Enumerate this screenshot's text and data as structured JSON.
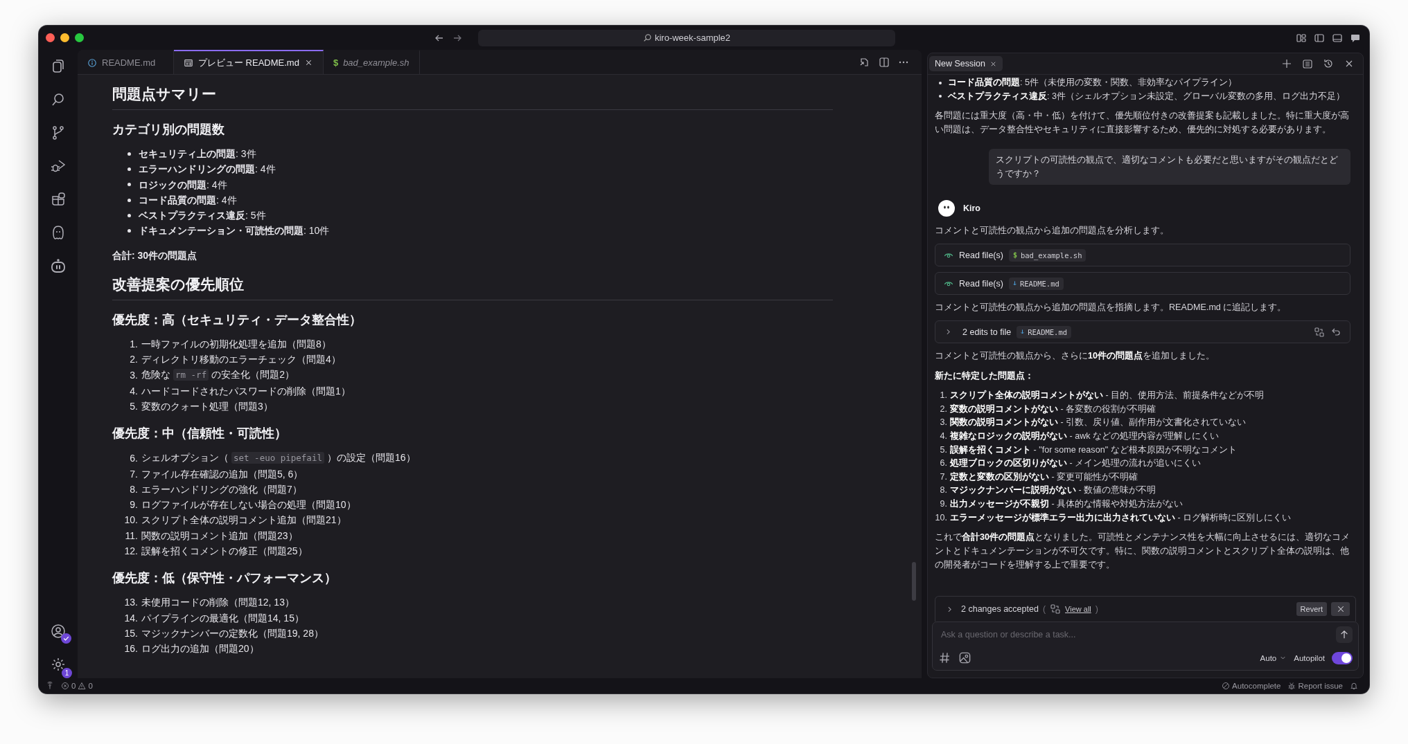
{
  "window": {
    "search_label": "kiro-week-sample2"
  },
  "activity_bar": {
    "settings_badge": "1"
  },
  "editor": {
    "tabs": [
      {
        "label": "README.md",
        "kind": "info",
        "selected": false,
        "preview_mode": false
      },
      {
        "label": "プレビュー README.md",
        "kind": "preview",
        "selected": true,
        "preview_mode": false
      },
      {
        "label": "bad_example.sh",
        "kind": "shell",
        "glyph": "$",
        "selected": false,
        "preview_mode": true
      }
    ],
    "blocks": [
      {
        "kind": "h1",
        "text": "問題点サマリー"
      },
      {
        "kind": "h2",
        "text": "カテゴリ別の問題数"
      },
      {
        "kind": "ul",
        "items": [
          "**セキュリティ上の問題**: 3件",
          "**エラーハンドリングの問題**: 4件",
          "**ロジックの問題**: 4件",
          "**コード品質の問題**: 4件",
          "**ベストプラクティス違反**: 5件",
          "**ドキュメンテーション・可読性の問題**: 10件"
        ]
      },
      {
        "kind": "p",
        "bold": true,
        "text": "合計: 30件の問題点"
      },
      {
        "kind": "h1",
        "text": "改善提案の優先順位"
      },
      {
        "kind": "h2",
        "text": "優先度：高（セキュリティ・データ整合性）"
      },
      {
        "kind": "ol",
        "items": [
          {
            "number": "1.",
            "text": "一時ファイルの初期化処理を追加（問題8）"
          },
          {
            "number": "2.",
            "text": "ディレクトリ移動のエラーチェック（問題4）"
          },
          {
            "number": "3.",
            "text": "危険な",
            "code": "rm -rf",
            "after": "の安全化（問題2）"
          },
          {
            "number": "4.",
            "text": "ハードコードされたパスワードの削除（問題1）"
          },
          {
            "number": "5.",
            "text": "変数のクォート処理（問題3）"
          }
        ]
      },
      {
        "kind": "h2",
        "text": "優先度：中（信頼性・可読性）"
      },
      {
        "kind": "ol",
        "items": [
          {
            "number": "6.",
            "text": "シェルオプション（",
            "code": "set -euo pipefail",
            "after": "）の設定（問題16）"
          },
          {
            "number": "7.",
            "text": "ファイル存在確認の追加（問題5, 6）"
          },
          {
            "number": "8.",
            "text": "エラーハンドリングの強化（問題7）"
          },
          {
            "number": "9.",
            "text": "ログファイルが存在しない場合の処理（問題10）"
          },
          {
            "number": "10.",
            "text": "スクリプト全体の説明コメント追加（問題21）"
          },
          {
            "number": "11.",
            "text": "関数の説明コメント追加（問題23）"
          },
          {
            "number": "12.",
            "text": "誤解を招くコメントの修正（問題25）"
          }
        ]
      },
      {
        "kind": "h2",
        "text": "優先度：低（保守性・パフォーマンス）"
      },
      {
        "kind": "ol",
        "items": [
          {
            "number": "13.",
            "text": "未使用コードの削除（問題12, 13）"
          },
          {
            "number": "14.",
            "text": "パイプラインの最適化（問題14, 15）"
          },
          {
            "number": "15.",
            "text": "マジックナンバーの定数化（問題19, 28）"
          },
          {
            "number": "16.",
            "text": "ログ出力の追加（問題20）"
          }
        ]
      }
    ]
  },
  "chat": {
    "tab": "New Session",
    "messages": [
      {
        "kind": "ul",
        "items": [
          "**コード品質の問題**: 5件（未使用の変数・関数、非効率なパイプライン）",
          "**ベストプラクティス違反**: 3件（シェルオプション未設定、グローバル変数の多用、ログ出力不足）"
        ]
      },
      {
        "kind": "p",
        "text": "各問題には重大度（高・中・低）を付けて、優先順位付きの改善提案も記載しました。特に重大度が高い問題は、データ整合性やセキュリティに直接影響するため、優先的に対処する必要があります。"
      },
      {
        "kind": "user",
        "text": "スクリプトの可読性の観点で、適切なコメントも必要だと思いますがその観点だとどうですか？"
      },
      {
        "kind": "author",
        "text": "Kiro"
      },
      {
        "kind": "p",
        "text": "コメントと可読性の観点から追加の問題点を分析します。"
      },
      {
        "kind": "tool",
        "text": "Read file(s)",
        "file": "bad_example.sh",
        "glyph": "$"
      },
      {
        "kind": "tool",
        "text": "Read file(s)",
        "file": "README.md"
      },
      {
        "kind": "p",
        "text": "コメントと可読性の観点から追加の問題点を指摘します。README.md に追記します。"
      },
      {
        "kind": "edits",
        "text": "2 edits to file",
        "file": "README.md"
      },
      {
        "kind": "p",
        "text": "コメントと可読性の観点から、さらに**10件の問題点**を追加しました。"
      },
      {
        "kind": "p",
        "bold": true,
        "text": "新たに特定した問題点："
      },
      {
        "kind": "ol",
        "items": [
          {
            "number": "1.",
            "text": "**スクリプト全体の説明コメントがない** - 目的、使用方法、前提条件などが不明"
          },
          {
            "number": "2.",
            "text": "**変数の説明コメントがない** - 各変数の役割が不明確"
          },
          {
            "number": "3.",
            "text": "**関数の説明コメントがない** - 引数、戻り値、副作用が文書化されていない"
          },
          {
            "number": "4.",
            "text": "**複雑なロジックの説明がない** - awk などの処理内容が理解しにくい"
          },
          {
            "number": "5.",
            "text": "**誤解を招くコメント** - \"for some reason\" など根本原因が不明なコメント"
          },
          {
            "number": "6.",
            "text": "**処理ブロックの区切りがない** - メイン処理の流れが追いにくい"
          },
          {
            "number": "7.",
            "text": "**定数と変数の区別がない** - 変更可能性が不明確"
          },
          {
            "number": "8.",
            "text": "**マジックナンバーに説明がない** - 数値の意味が不明"
          },
          {
            "number": "9.",
            "text": "**出力メッセージが不親切** - 具体的な情報や対処方法がない"
          },
          {
            "number": "10.",
            "text": "**エラーメッセージが標準エラー出力に出力されていない** - ログ解析時に区別しにくい"
          }
        ]
      },
      {
        "kind": "p",
        "text": "これで**合計30件の問題点**となりました。可読性とメンテナンス性を大幅に向上させるには、適切なコメントとドキュメンテーションが不可欠です。特に、関数の説明コメントとスクリプト全体の説明は、他の開発者がコードを理解する上で重要です。"
      }
    ],
    "changes": {
      "label": "2 changes accepted",
      "open_paren": "(",
      "link": "View all",
      "close_paren": ")",
      "revert": "Revert"
    },
    "composer": {
      "placeholder": "Ask a question or describe a task...",
      "mode": "Auto",
      "autopilot_label": "Autopilot",
      "autopilot_on": true
    }
  },
  "status_bar": {
    "errors": "0",
    "warnings": "0",
    "autocomplete": "Autocomplete",
    "report": "Report issue"
  }
}
